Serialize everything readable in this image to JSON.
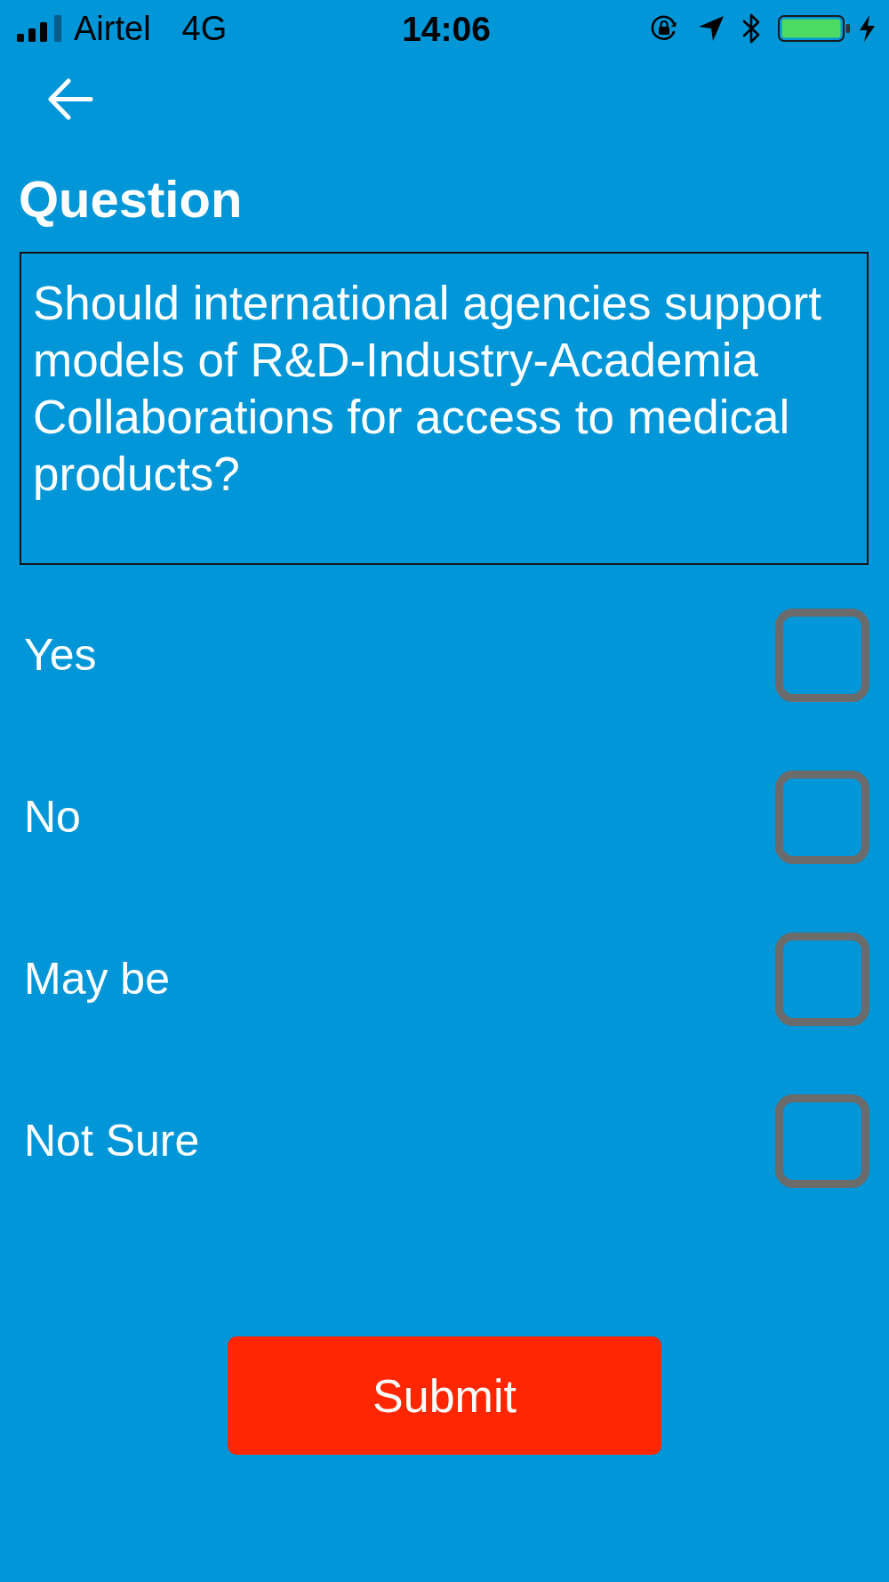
{
  "status_bar": {
    "carrier": "Airtel",
    "network": "4G",
    "time": "14:06"
  },
  "header": {
    "title": "Question"
  },
  "question": {
    "text": "Should international agencies support models of R&D-Industry-Academia Collaborations for access to medical products?"
  },
  "options": [
    {
      "label": "Yes",
      "checked": false
    },
    {
      "label": "No",
      "checked": false
    },
    {
      "label": "May be",
      "checked": false
    },
    {
      "label": "Not Sure",
      "checked": false
    }
  ],
  "submit_button": {
    "label": "Submit"
  }
}
